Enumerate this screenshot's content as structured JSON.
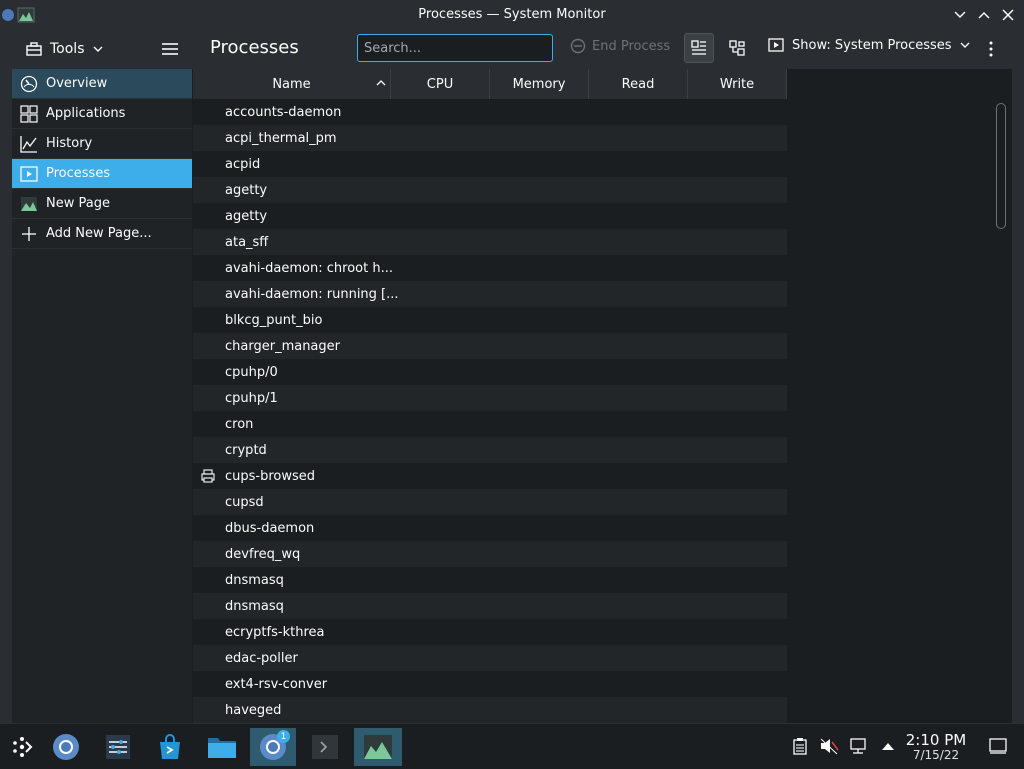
{
  "window": {
    "title": "Processes — System Monitor"
  },
  "toolbar": {
    "tools_label": "Tools",
    "page_title": "Processes",
    "search_placeholder": "Search...",
    "end_process_label": "End Process",
    "show_label": "Show: System Processes"
  },
  "sidebar": {
    "items": [
      {
        "label": "Overview",
        "icon": "speedometer-icon"
      },
      {
        "label": "Applications",
        "icon": "grid-icon"
      },
      {
        "label": "History",
        "icon": "chart-icon"
      },
      {
        "label": "Processes",
        "icon": "process-icon"
      },
      {
        "label": "New Page",
        "icon": "image-icon"
      },
      {
        "label": "Add New Page...",
        "icon": "plus-icon"
      }
    ],
    "selected": "Processes"
  },
  "table": {
    "columns": [
      "Name",
      "CPU",
      "Memory",
      "Read",
      "Write"
    ],
    "sort_column": "Name",
    "rows": [
      "accounts-daemon",
      "acpi_thermal_pm",
      "acpid",
      "agetty",
      "agetty",
      "ata_sff",
      "avahi-daemon: chroot h...",
      "avahi-daemon: running [...",
      "blkcg_punt_bio",
      "charger_manager",
      "cpuhp/0",
      "cpuhp/1",
      "cron",
      "cryptd",
      "cups-browsed",
      "cupsd",
      "dbus-daemon",
      "devfreq_wq",
      "dnsmasq",
      "dnsmasq",
      "ecryptfs-kthrea",
      "edac-poller",
      "ext4-rsv-conver",
      "haveged"
    ]
  },
  "taskbar": {
    "time": "2:10 PM",
    "date": "7/15/22",
    "chrome_badge": "1"
  },
  "colors": {
    "accent": "#3daee9",
    "background": "#1b1e20",
    "panel": "#2a2e32"
  }
}
